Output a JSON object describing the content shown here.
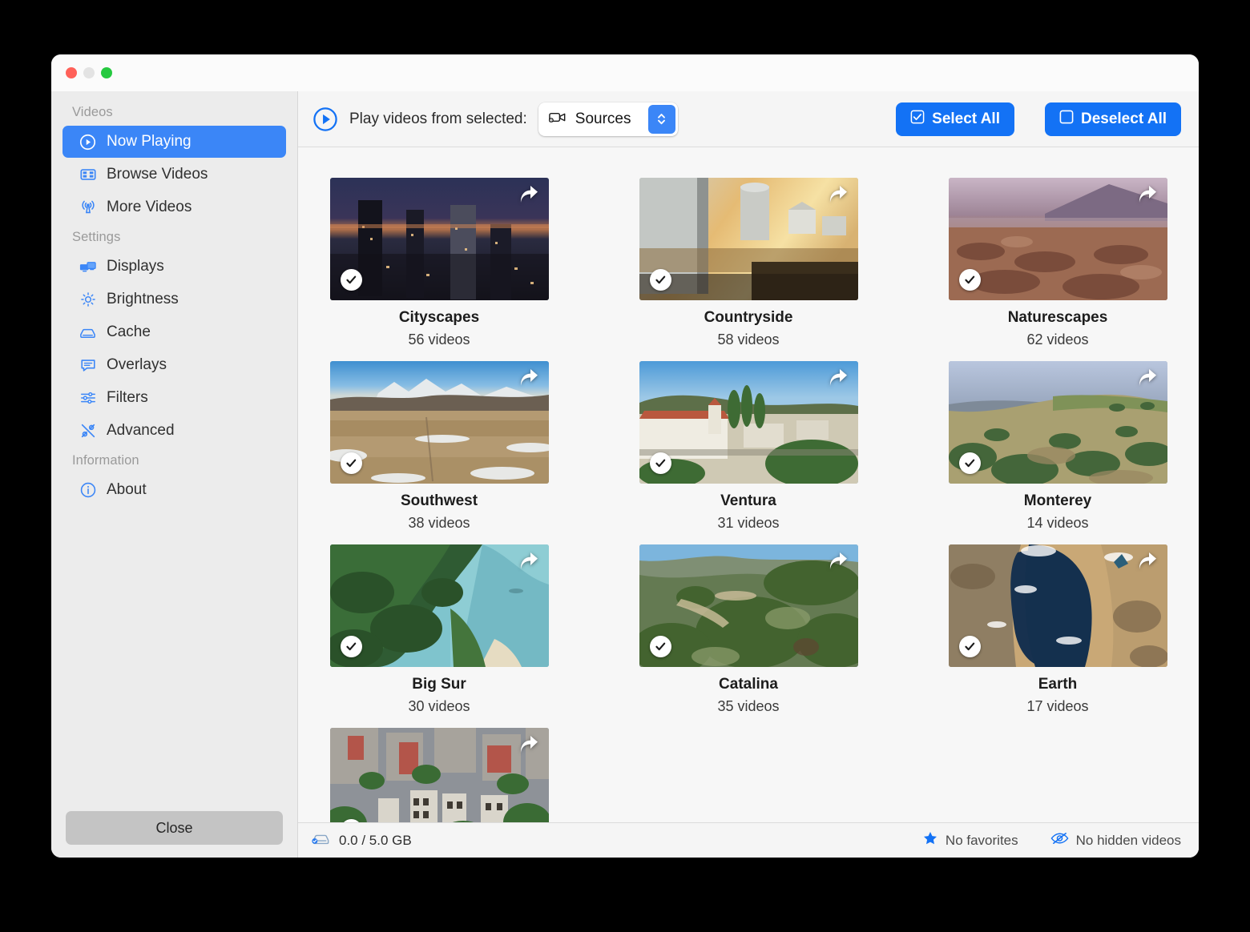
{
  "window": {
    "traffic_lights": [
      "close",
      "minimize",
      "zoom"
    ]
  },
  "sidebar": {
    "sections": [
      {
        "title": "Videos",
        "items": [
          {
            "label": "Now Playing",
            "icon": "play-circle-icon",
            "active": true
          },
          {
            "label": "Browse Videos",
            "icon": "film-icon",
            "active": false
          },
          {
            "label": "More Videos",
            "icon": "antenna-icon",
            "active": false
          }
        ]
      },
      {
        "title": "Settings",
        "items": [
          {
            "label": "Displays",
            "icon": "displays-icon",
            "active": false
          },
          {
            "label": "Brightness",
            "icon": "brightness-icon",
            "active": false
          },
          {
            "label": "Cache",
            "icon": "drive-icon",
            "active": false
          },
          {
            "label": "Overlays",
            "icon": "speech-bubble-icon",
            "active": false
          },
          {
            "label": "Filters",
            "icon": "sliders-icon",
            "active": false
          },
          {
            "label": "Advanced",
            "icon": "tools-icon",
            "active": false
          }
        ]
      },
      {
        "title": "Information",
        "items": [
          {
            "label": "About",
            "icon": "info-circle-icon",
            "active": false
          }
        ]
      }
    ],
    "close_label": "Close"
  },
  "toolbar": {
    "play_icon": "play-circle-icon",
    "label": "Play videos from selected:",
    "popup_icon": "video-source-icon",
    "popup_value": "Sources",
    "popup_options": [
      "Sources"
    ],
    "select_all_label": "Select All",
    "deselect_all_label": "Deselect All",
    "select_all_icon": "checked-box-icon",
    "deselect_all_icon": "empty-box-icon",
    "accent_color": "#1372f5"
  },
  "grid": {
    "cards": [
      {
        "title": "Cityscapes",
        "count": "56 videos",
        "checked": true,
        "share_icon": "share-arrow-icon",
        "scene": "city-night"
      },
      {
        "title": "Countryside",
        "count": "58 videos",
        "checked": true,
        "share_icon": "share-arrow-icon",
        "scene": "farm-sunset"
      },
      {
        "title": "Naturescapes",
        "count": "62 videos",
        "checked": true,
        "share_icon": "share-arrow-icon",
        "scene": "desert-dusk"
      },
      {
        "title": "Southwest",
        "count": "38 videos",
        "checked": true,
        "share_icon": "share-arrow-icon",
        "scene": "plains-snow"
      },
      {
        "title": "Ventura",
        "count": "31 videos",
        "checked": true,
        "share_icon": "share-arrow-icon",
        "scene": "mission-town"
      },
      {
        "title": "Monterey",
        "count": "14 videos",
        "checked": true,
        "share_icon": "share-arrow-icon",
        "scene": "green-hills"
      },
      {
        "title": "Big Sur",
        "count": "30 videos",
        "checked": true,
        "share_icon": "share-arrow-icon",
        "scene": "coast-cliffs"
      },
      {
        "title": "Catalina",
        "count": "35 videos",
        "checked": true,
        "share_icon": "share-arrow-icon",
        "scene": "chaparral"
      },
      {
        "title": "Earth",
        "count": "17 videos",
        "checked": true,
        "share_icon": "share-arrow-icon",
        "scene": "orbit-sea"
      },
      {
        "title": "",
        "count": "",
        "checked": true,
        "share_icon": "share-arrow-icon",
        "scene": "rowhouses"
      }
    ]
  },
  "statusbar": {
    "cache_icon": "drive-check-icon",
    "cache_text": "0.0 / 5.0 GB",
    "favorites_icon": "star-icon",
    "favorites_text": "No favorites",
    "hidden_icon": "eye-slash-icon",
    "hidden_text": "No hidden videos"
  }
}
